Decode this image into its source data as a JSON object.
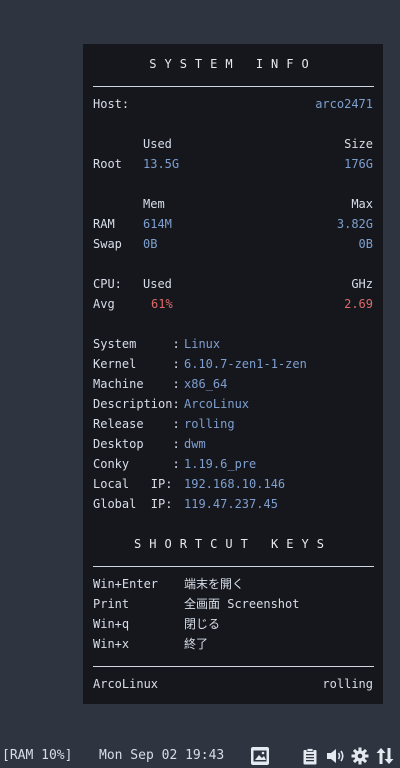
{
  "conky": {
    "title": "SYSTEM INFO",
    "host_label": "Host:",
    "host_value": "arco2471",
    "disk": {
      "used_hdr": "Used",
      "size_hdr": "Size",
      "root_label": "Root",
      "root_used": "13.5G",
      "root_size": "176G"
    },
    "memory": {
      "mem_hdr": "Mem",
      "max_hdr": "Max",
      "ram_label": "RAM",
      "ram_used": "614M",
      "ram_max": "3.82G",
      "swap_label": "Swap",
      "swap_used": "0B",
      "swap_max": "0B"
    },
    "cpu": {
      "label": "CPU:",
      "used_hdr": "Used",
      "ghz_hdr": "GHz",
      "avg_label": "Avg",
      "avg_used": "61%",
      "avg_ghz": "2.69"
    },
    "info": [
      {
        "label": "System     :",
        "value": "Linux"
      },
      {
        "label": "Kernel     :",
        "value": "6.10.7-zen1-1-zen"
      },
      {
        "label": "Machine    :",
        "value": "x86_64"
      },
      {
        "label": "Description:",
        "value": "ArcoLinux"
      },
      {
        "label": "Release    :",
        "value": "rolling"
      },
      {
        "label": "Desktop    :",
        "value": "dwm"
      },
      {
        "label": "Conky      :",
        "value": "1.19.6_pre"
      },
      {
        "label": "Local   IP:",
        "value": "192.168.10.146"
      },
      {
        "label": "Global  IP:",
        "value": "119.47.237.45"
      }
    ],
    "shortcuts_title": "SHORTCUT KEYS",
    "shortcuts": [
      {
        "key": "Win+Enter",
        "action": "端末を開く"
      },
      {
        "key": "Print",
        "action": "全画面 Screenshot"
      },
      {
        "key": "Win+q",
        "action": "閉じる"
      },
      {
        "key": "Win+x",
        "action": "終了"
      }
    ],
    "footer_left": "ArcoLinux",
    "footer_right": "rolling"
  },
  "statusbar": {
    "ram": "[RAM 10%]",
    "datetime": "Mon Sep 02 19:43",
    "icons": [
      "image-icon",
      "clipboard-icon",
      "volume-icon",
      "settings-icon",
      "network-icon"
    ]
  },
  "colors": {
    "value_blue": "#7f9fd0",
    "alert_red": "#e06a6a",
    "panel_bg": "#15171c",
    "desktop_bg": "#2e3440"
  }
}
